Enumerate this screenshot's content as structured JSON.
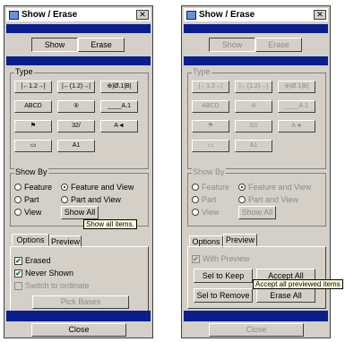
{
  "window_title": "Show / Erase",
  "close_glyph": "✕",
  "left": {
    "tabs": [
      "Show",
      "Erase"
    ],
    "type_legend": "Type",
    "type_buttons": [
      "|←1.2→|",
      "|←(1.2)→|",
      "⊕|Ø.1|B|",
      "ABCD",
      "⑤",
      "____A.1",
      "⚑",
      "32/",
      "A◄",
      "▭",
      "A1"
    ],
    "show_by_legend": "Show By",
    "radios": {
      "feature": "Feature",
      "feature_and_view": "Feature and View",
      "part": "Part",
      "part_and_view": "Part and View",
      "view": "View"
    },
    "show_all": "Show All",
    "tooltip": "Show all items.",
    "subtabs": [
      "Options",
      "Preview"
    ],
    "erased": "Erased",
    "never_shown": "Never Shown",
    "switch_to_ordinate": "Switch to ordinate",
    "pick_bases": "Pick Bases",
    "close": "Close"
  },
  "right": {
    "tabs": [
      "Show",
      "Erase"
    ],
    "type_legend": "Type",
    "type_buttons": [
      "|←1.2→|",
      "|←(1.2)→|",
      "⊕|Ø.1|B|",
      "ABCD",
      "⑤",
      "____A.1",
      "⚑",
      "32/",
      "A◄",
      "▭",
      "A1"
    ],
    "show_by_legend": "Show By",
    "radios": {
      "feature": "Feature",
      "feature_and_view": "Feature and View",
      "part": "Part",
      "part_and_view": "Part and View",
      "view": "View"
    },
    "show_all": "Show All",
    "subtabs": [
      "Options",
      "Preview"
    ],
    "with_preview": "With Preview",
    "sel_to_keep": "Sel to Keep",
    "accept_all": "Accept All",
    "sel_to_remove": "Sel to Remove",
    "erase_all": "Erase All",
    "tooltip": "Accept all previewed items",
    "close": "Close"
  }
}
